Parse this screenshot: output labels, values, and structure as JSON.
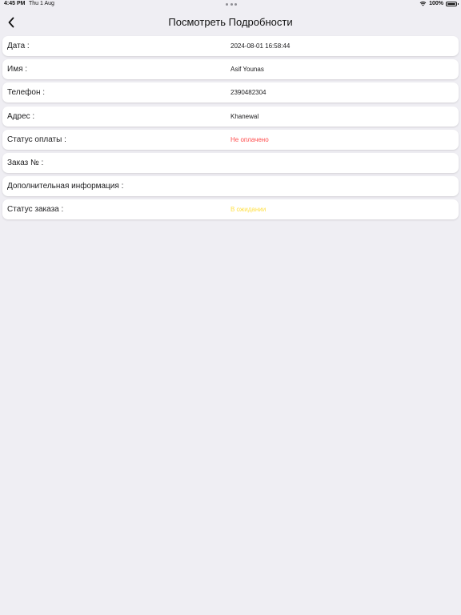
{
  "status_bar": {
    "time": "4:45 PM",
    "date": "Thu 1 Aug",
    "battery": "100%"
  },
  "nav": {
    "title": "Посмотреть Подробности"
  },
  "details": [
    {
      "label": "Дата :",
      "value": "2024-08-01 16:58:44"
    },
    {
      "label": "Имя :",
      "value": "Asif Younas"
    },
    {
      "label": "Телефон :",
      "value": "2390482304"
    },
    {
      "label": "Адрес :",
      "value": "Khanewal"
    },
    {
      "label": "Статус оплаты :",
      "value": "Не оплачено"
    },
    {
      "label": "Заказ № :",
      "value": ""
    },
    {
      "label": "Дополнительная информация :",
      "value": ""
    },
    {
      "label": "Статус заказа :",
      "value": "В ожидании"
    }
  ],
  "colors": {
    "payment_status": "#ff4d4d",
    "order_status": "#ffe14a",
    "background": "#efeef3"
  },
  "icons": {
    "back": "chevron-left-icon",
    "wifi": "wifi-icon",
    "battery": "battery-icon"
  }
}
